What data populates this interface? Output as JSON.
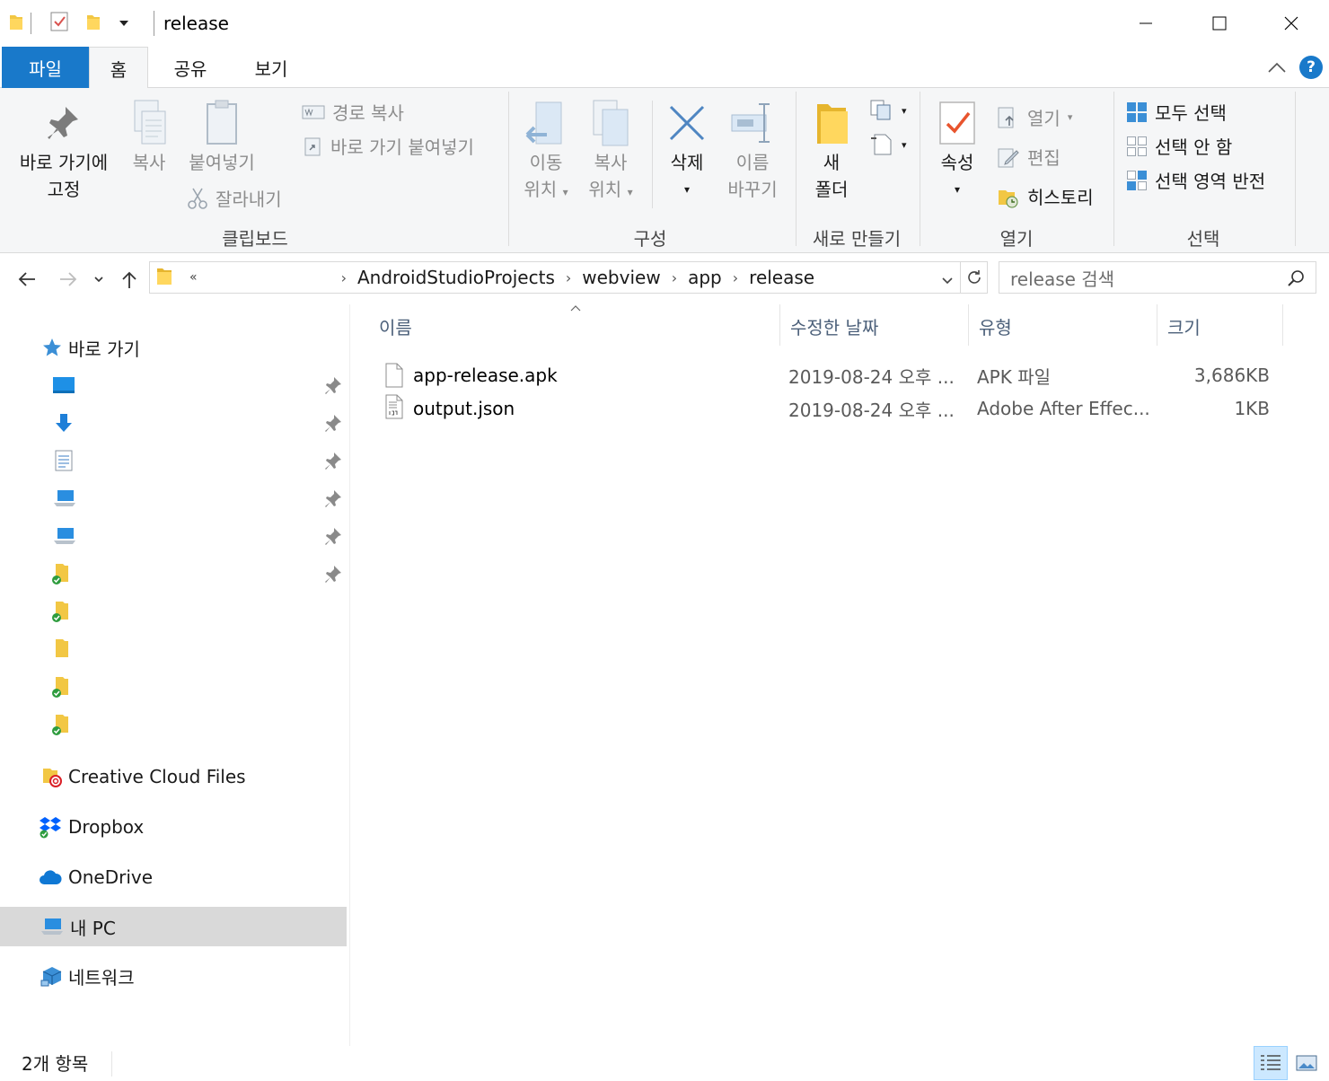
{
  "window": {
    "title": "release"
  },
  "ribbon_tabs": [
    {
      "label": "파일"
    },
    {
      "label": "홈"
    },
    {
      "label": "공유"
    },
    {
      "label": "보기"
    }
  ],
  "help_label": "?",
  "clipboard": {
    "pin_label_1": "바로 가기에",
    "pin_label_2": "고정",
    "copy_label": "복사",
    "paste_label": "붙여넣기",
    "copy_path_label": "경로 복사",
    "paste_shortcut_label": "바로 가기 붙여넣기",
    "cut_label": "잘라내기",
    "group_label": "클립보드"
  },
  "organize": {
    "move_label_1": "이동",
    "move_label_2": "위치",
    "copyto_label_1": "복사",
    "copyto_label_2": "위치",
    "delete_label": "삭제",
    "rename_label_1": "이름",
    "rename_label_2": "바꾸기",
    "group_label": "구성"
  },
  "new": {
    "new_folder_label_1": "새",
    "new_folder_label_2": "폴더",
    "group_label": "새로 만들기"
  },
  "open": {
    "properties_label": "속성",
    "open_label": "열기",
    "edit_label": "편집",
    "history_label": "히스토리",
    "group_label": "열기"
  },
  "select": {
    "select_all_label": "모두 선택",
    "select_none_label": "선택 안 함",
    "invert_label": "선택 영역 반전",
    "group_label": "선택"
  },
  "address": {
    "overflow": "«",
    "crumbs": [
      "AndroidStudioProjects",
      "webview",
      "app",
      "release"
    ]
  },
  "search": {
    "placeholder": "release 검색"
  },
  "nav_pane": {
    "quick_access_label": "바로 가기",
    "creative_cloud_label": "Creative Cloud Files",
    "dropbox_label": "Dropbox",
    "onedrive_label": "OneDrive",
    "this_pc_label": "내 PC",
    "network_label": "네트워크"
  },
  "columns": {
    "name": "이름",
    "date": "수정한 날짜",
    "type": "유형",
    "size": "크기"
  },
  "files": [
    {
      "name": "app-release.apk",
      "date": "2019-08-24 오후 ...",
      "type": "APK 파일",
      "size": "3,686KB",
      "icon": "blank-file-icon"
    },
    {
      "name": "output.json",
      "date": "2019-08-24 오후 ...",
      "type": "Adobe After Effec...",
      "size": "1KB",
      "icon": "json-file-icon"
    }
  ],
  "status": {
    "count": "2개 항목"
  },
  "colors": {
    "accent": "#1979ca",
    "ribbon_bg": "#f5f6f7",
    "folder_yellow": "#f2c744"
  }
}
